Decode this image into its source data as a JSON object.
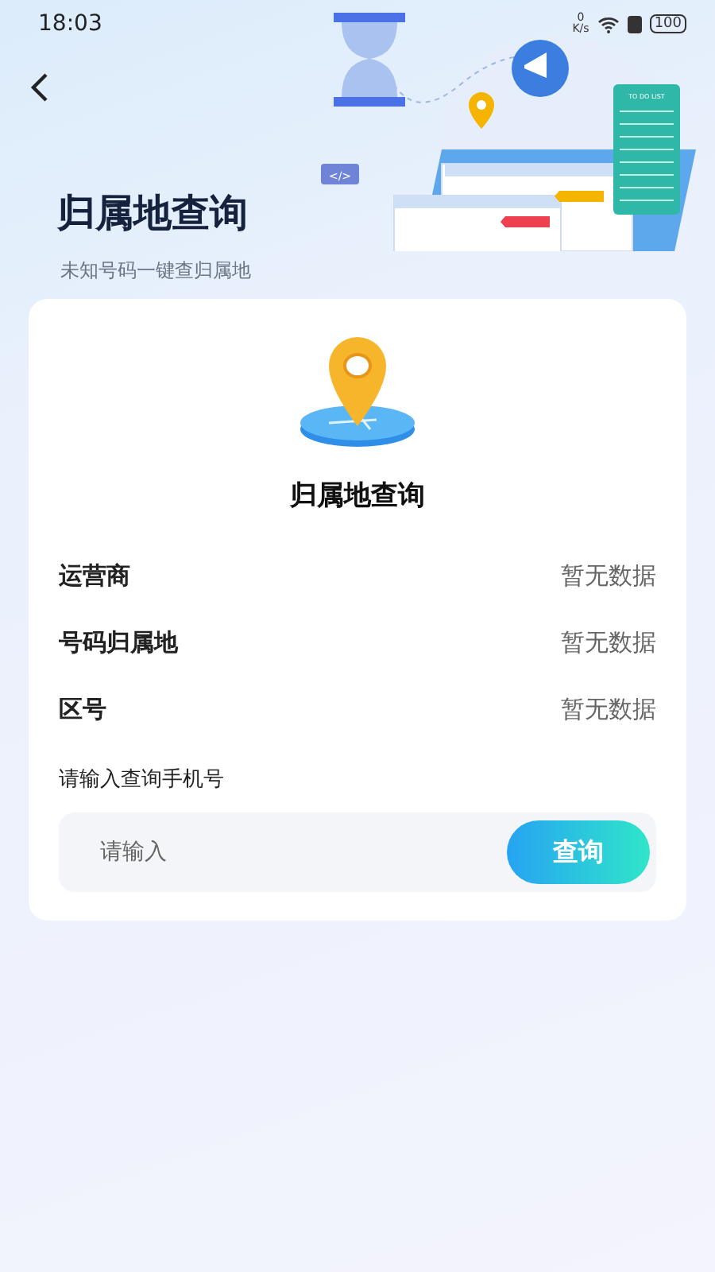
{
  "status_bar": {
    "time": "18:03",
    "net_speed_value": "0",
    "net_speed_unit": "K/s",
    "battery": "100"
  },
  "header": {
    "title": "归属地查询",
    "subtitle": "未知号码一键查归属地",
    "illustration": {
      "code_tag": "</>",
      "list_title": "TO DO LIST"
    }
  },
  "card": {
    "title": "归属地查询",
    "rows": [
      {
        "label": "运营商",
        "value": "暂无数据"
      },
      {
        "label": "号码归属地",
        "value": "暂无数据"
      },
      {
        "label": "区号",
        "value": "暂无数据"
      }
    ],
    "input_label": "请输入查询手机号",
    "placeholder": "请输入",
    "button": "查询"
  }
}
